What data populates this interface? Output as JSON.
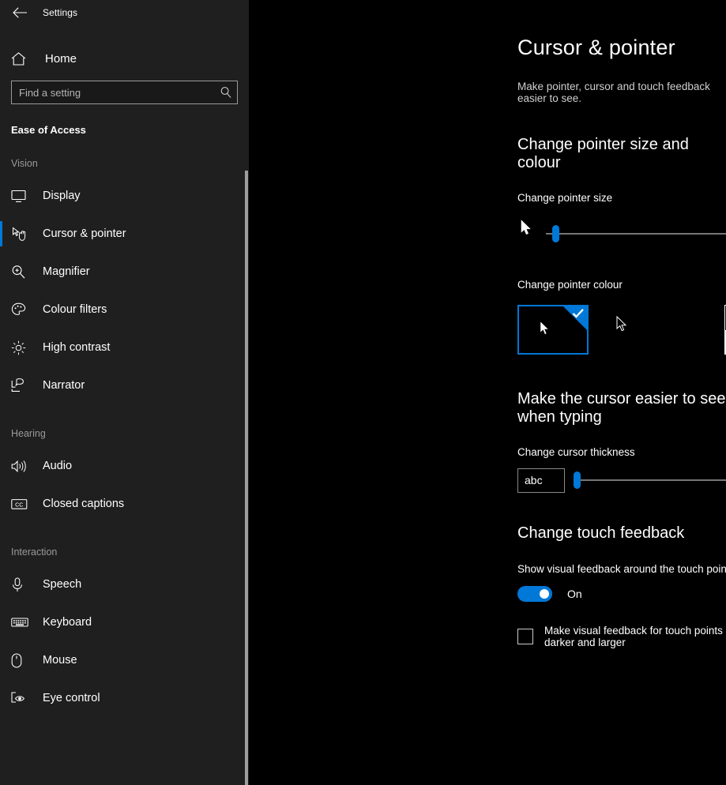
{
  "window": {
    "back_icon": "back-arrow-icon",
    "app_title": "Settings"
  },
  "sidebar": {
    "home": {
      "label": "Home",
      "icon": "home-icon"
    },
    "search": {
      "value": "",
      "placeholder": "Find a setting",
      "icon": "search-icon"
    },
    "category_title": "Ease of Access",
    "groups": [
      {
        "name": "Vision",
        "items": [
          {
            "label": "Display",
            "icon": "monitor-icon",
            "selected": false
          },
          {
            "label": "Cursor & pointer",
            "icon": "cursor-hand-icon",
            "selected": true
          },
          {
            "label": "Magnifier",
            "icon": "magnifier-plus-icon",
            "selected": false
          },
          {
            "label": "Colour filters",
            "icon": "palette-icon",
            "selected": false
          },
          {
            "label": "High contrast",
            "icon": "brightness-icon",
            "selected": false
          },
          {
            "label": "Narrator",
            "icon": "narrator-speech-icon",
            "selected": false
          }
        ]
      },
      {
        "name": "Hearing",
        "items": [
          {
            "label": "Audio",
            "icon": "speaker-icon",
            "selected": false
          },
          {
            "label": "Closed captions",
            "icon": "cc-icon",
            "selected": false
          }
        ]
      },
      {
        "name": "Interaction",
        "items": [
          {
            "label": "Speech",
            "icon": "microphone-icon",
            "selected": false
          },
          {
            "label": "Keyboard",
            "icon": "keyboard-icon",
            "selected": false
          },
          {
            "label": "Mouse",
            "icon": "mouse-icon",
            "selected": false
          },
          {
            "label": "Eye control",
            "icon": "eye-control-icon",
            "selected": false
          }
        ]
      }
    ]
  },
  "main": {
    "page_title": "Cursor & pointer",
    "page_subtitle": "Make pointer, cursor and touch feedback easier to see.",
    "pointer_section": {
      "heading": "Change pointer size and colour",
      "size_label": "Change pointer size",
      "size_value_percent": 3,
      "colour_label": "Change pointer colour",
      "swatches": [
        {
          "name": "white-pointer",
          "selected": true
        },
        {
          "name": "black-pointer",
          "selected": false
        },
        {
          "name": "inverted-pointer",
          "selected": false
        },
        {
          "name": "custom-colour-pointer",
          "selected": false
        }
      ]
    },
    "cursor_section": {
      "heading": "Make the cursor easier to see when typing",
      "thickness_label": "Change cursor thickness",
      "preview_text": "abc",
      "thickness_value_percent": 0
    },
    "touch_section": {
      "heading": "Change touch feedback",
      "toggle_description": "Show visual feedback around the touch points when I touch the screen",
      "toggle_state": "On",
      "toggle_on": true,
      "checkbox_label": "Make visual feedback for touch points darker and larger",
      "checkbox_checked": false
    }
  },
  "colors": {
    "accent": "#0078d7",
    "sidebar_bg": "#1f1f1f",
    "main_bg": "#000000",
    "text": "#ffffff",
    "muted_text": "#9a9a9a"
  }
}
